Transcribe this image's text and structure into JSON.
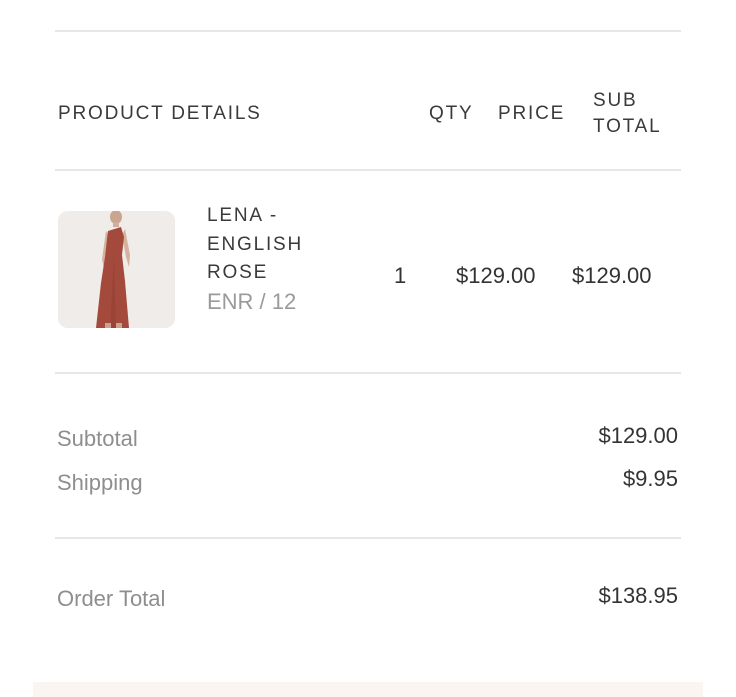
{
  "table_header": {
    "product_details": "PRODUCT DETAILS",
    "qty": "QTY",
    "price": "PRICE",
    "sub_total_line1": "SUB",
    "sub_total_line2": "TOTAL"
  },
  "line_items": [
    {
      "name_lines": [
        "LENA -",
        "ENGLISH",
        "ROSE"
      ],
      "variant": "ENR / 12",
      "qty": "1",
      "price": "$129.00",
      "subtotal": "$129.00",
      "image_icon": "dress-product-image"
    }
  ],
  "summary": {
    "subtotal_label": "Subtotal",
    "subtotal_value": "$129.00",
    "shipping_label": "Shipping",
    "shipping_value": "$9.95",
    "order_total_label": "Order Total",
    "order_total_value": "$138.95"
  },
  "colors": {
    "dress": "#a44a3c",
    "thumb_bg": "#efecea",
    "divider": "#e7e7e7"
  }
}
